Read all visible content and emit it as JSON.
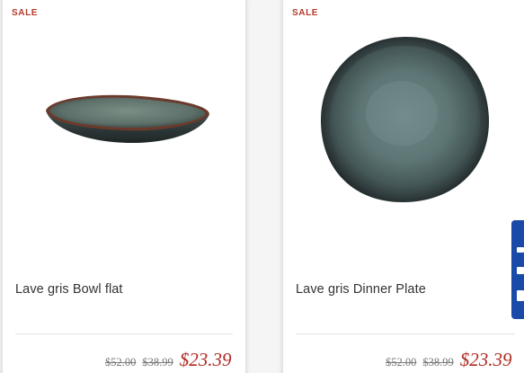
{
  "products": [
    {
      "badge": "SALE",
      "name": "Lave gris Bowl flat",
      "price_original_1": "$52.00",
      "price_original_2": "$38.99",
      "price_sale": "$23.39"
    },
    {
      "badge": "SALE",
      "name": "Lave gris Dinner Plate",
      "price_original_1": "$52.00",
      "price_original_2": "$38.99",
      "price_sale": "$23.39"
    }
  ],
  "colors": {
    "sale_badge": "#b23a2b",
    "sale_price": "#b02a22",
    "side_widget": "#1a4aa8"
  }
}
